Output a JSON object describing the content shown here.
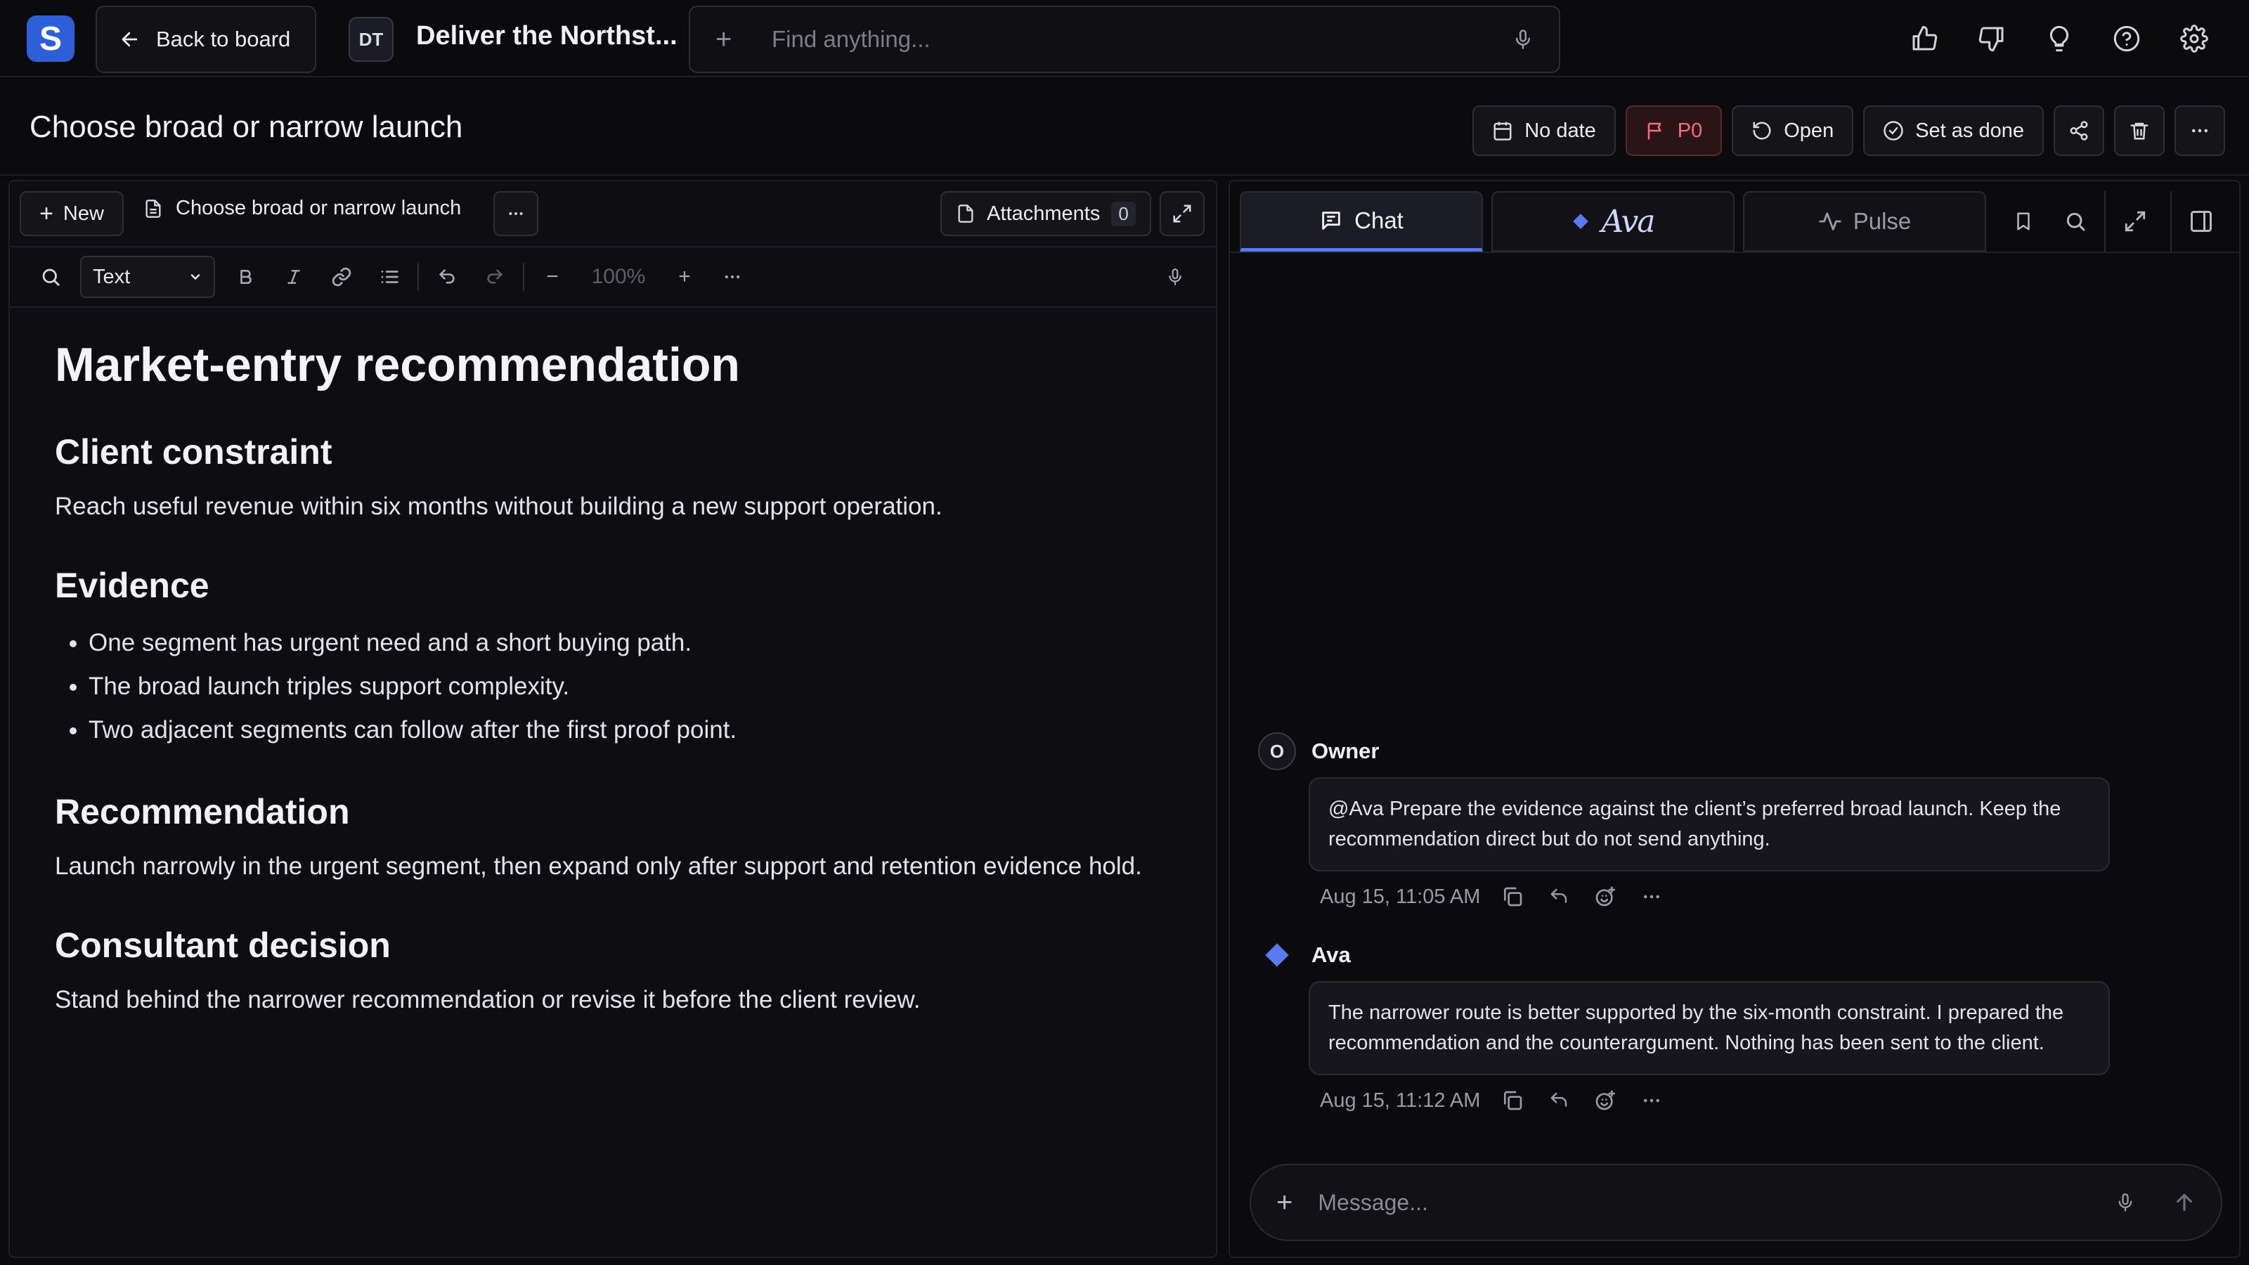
{
  "app": {
    "logo_letter": "S",
    "accent": "#2f5fd8"
  },
  "topbar": {
    "back_label": "Back to board",
    "project_initials": "DT",
    "project_title": "Deliver the Northst...",
    "search_placeholder": "Find anything...",
    "icons": [
      "thumbs-up-icon",
      "thumbs-down-icon",
      "lightbulb-icon",
      "help-icon",
      "settings-icon"
    ]
  },
  "task": {
    "title": "Choose broad or narrow launch",
    "date_label": "No date",
    "priority_label": "P0",
    "status_label": "Open",
    "done_label": "Set as done"
  },
  "editor": {
    "new_label": "New",
    "doc_tab_label": "Choose broad or narrow launch",
    "attachments_label": "Attachments",
    "attachments_count": "0",
    "format_value": "Text",
    "zoom": "100%",
    "doc": {
      "title": "Market-entry recommendation",
      "sections": [
        {
          "heading": "Client constraint",
          "text": "Reach useful revenue within six months without building a new support operation."
        },
        {
          "heading": "Evidence",
          "bullets": [
            "One segment has urgent need and a short buying path.",
            "The broad launch triples support complexity.",
            "Two adjacent segments can follow after the first proof point."
          ]
        },
        {
          "heading": "Recommendation",
          "text": "Launch narrowly in the urgent segment, then expand only after support and retention evidence hold."
        },
        {
          "heading": "Consultant decision",
          "text": "Stand behind the narrower recommendation or revise it before the client review."
        }
      ]
    }
  },
  "chat": {
    "tabs": {
      "chat": "Chat",
      "ava": "Ava",
      "pulse": "Pulse"
    },
    "messages": [
      {
        "avatar": "O",
        "author": "Owner",
        "text": "@Ava Prepare the evidence against the client’s preferred broad launch. Keep the recommendation direct but do not send anything.",
        "time": "Aug 15, 11:05 AM"
      },
      {
        "avatar": "",
        "author": "Ava",
        "text": "The narrower route is better supported by the six-month constraint. I prepared the recommendation and the counterargument. Nothing has been sent to the client.",
        "time": "Aug 15, 11:12 AM"
      }
    ],
    "composer_placeholder": "Message..."
  }
}
